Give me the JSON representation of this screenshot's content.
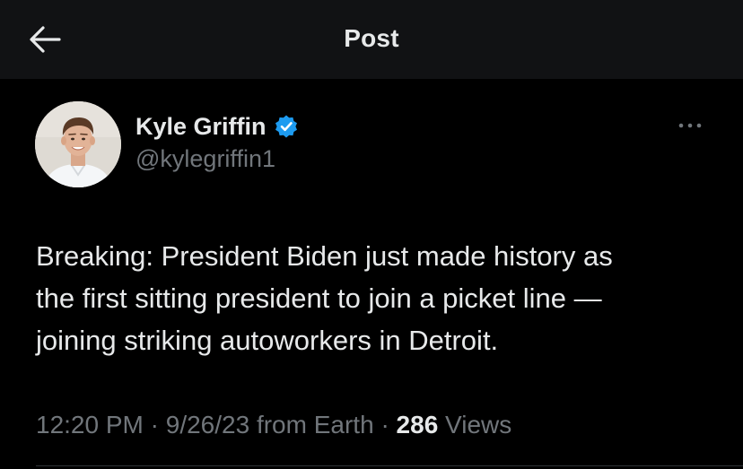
{
  "header": {
    "title": "Post",
    "back_icon": "arrow-left-icon"
  },
  "author": {
    "name": "Kyle Griffin",
    "handle": "@kylegriffin1",
    "verified": true,
    "verified_icon": "verified-badge-icon",
    "verified_color": "#1d9bf0",
    "more_icon": "more-horizontal-icon"
  },
  "post": {
    "text": "Breaking: President Biden just made history as\nthe first sitting president to join a picket line —\njoining striking autoworkers in Detroit."
  },
  "meta": {
    "time": "12:20 PM",
    "separator": "·",
    "date": "9/26/23",
    "source": "from Earth",
    "views_count": "286",
    "views_label": "Views"
  },
  "colors": {
    "background": "#000000",
    "header_background": "#111214",
    "text_primary": "#e7e9ea",
    "text_secondary": "#71767b",
    "accent": "#1d9bf0"
  }
}
